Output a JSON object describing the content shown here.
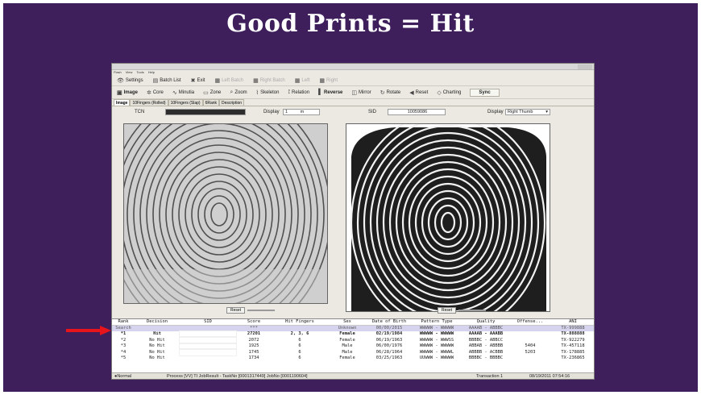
{
  "slide": {
    "title": "Good Prints = Hit"
  },
  "menu": [
    "Flash",
    "View",
    "Tools",
    "Help"
  ],
  "toolbar1": [
    {
      "label": "Settings",
      "icon": "eye-icon",
      "glyph": "👁"
    },
    {
      "label": "Batch List",
      "icon": "list-icon",
      "glyph": "▤"
    },
    {
      "label": "Exit",
      "icon": "exit-icon",
      "glyph": "✖"
    },
    {
      "label": "Left Batch",
      "icon": "grid-icon",
      "glyph": "▦"
    },
    {
      "label": "Right Batch",
      "icon": "grid-icon",
      "glyph": "▦"
    },
    {
      "label": "Left",
      "icon": "grid-icon",
      "glyph": "▦"
    },
    {
      "label": "Right",
      "icon": "grid-icon",
      "glyph": "▦"
    }
  ],
  "toolbar2": [
    {
      "label": "Image",
      "icon": "image-icon",
      "glyph": "▣"
    },
    {
      "label": "Core",
      "icon": "core-icon",
      "glyph": "✲"
    },
    {
      "label": "Minutia",
      "icon": "minutia-icon",
      "glyph": "∿"
    },
    {
      "label": "Zone",
      "icon": "zone-icon",
      "glyph": "▭"
    },
    {
      "label": "Zoom",
      "icon": "zoom-icon",
      "glyph": "⌕"
    },
    {
      "label": "Skeleton",
      "icon": "skeleton-icon",
      "glyph": "⌇"
    },
    {
      "label": "Relation",
      "icon": "relation-icon",
      "glyph": "⟟"
    },
    {
      "label": "Reverse",
      "icon": "reverse-icon",
      "glyph": "▌"
    },
    {
      "label": "Mirror",
      "icon": "mirror-icon",
      "glyph": "◫"
    },
    {
      "label": "Rotate",
      "icon": "rotate-icon",
      "glyph": "↻"
    },
    {
      "label": "Reset",
      "icon": "reset-icon",
      "glyph": "◀"
    },
    {
      "label": "Charting",
      "icon": "charting-icon",
      "glyph": "◇"
    }
  ],
  "sync_label": "Sync",
  "tabs": [
    "Image",
    "10Fingers (Rolled)",
    "10Fingers (Slap)",
    "6Rank",
    "Description"
  ],
  "fields": {
    "tcn_label": "TCN",
    "display_left_label": "Display",
    "display_left_value": "1",
    "display_left_unit": "m",
    "sid_label": "SID",
    "sid_value": "10059086",
    "display_right_label": "Display",
    "display_right_value": "Right Thumb"
  },
  "reset_label": "Reset",
  "table": {
    "headers": [
      "Rank",
      "Decision",
      "SID",
      "Score",
      "Hit Fingers",
      "Sex",
      "Date of Birth",
      "Pattern Type",
      "Quality",
      "Offense...",
      "ANI"
    ],
    "rows": [
      [
        "Search",
        "",
        "",
        "***",
        "",
        "Unknown",
        "00/00/2015",
        "WWWWW - WWWWW",
        "AAAAB - ABBBC",
        "",
        "TX-999888"
      ],
      [
        "*1",
        "Hit",
        "",
        "27201",
        "2, 3, 6",
        "Female",
        "02/19/1984",
        "WWWWW - WWWWW",
        "AAAAB - AAABB",
        "",
        "TX-888888"
      ],
      [
        "*2",
        "No Hit",
        "",
        "2072",
        "6",
        "Female",
        "06/19/1963",
        "WWWWW - WWWSS",
        "BBBBC - ABBCC",
        "",
        "TX-922279"
      ],
      [
        "*3",
        "No Hit",
        "",
        "1925",
        "6",
        "Male",
        "06/00/1976",
        "WWWWW - WWWWW",
        "ABBAB - ABBBB",
        "5404",
        "TX-457118"
      ],
      [
        "*4",
        "No Hit",
        "",
        "1745",
        "6",
        "Male",
        "06/28/1964",
        "WWWWW - WWWWL",
        "ABBBB - ACBBB",
        "5203",
        "TX-178885"
      ],
      [
        "*5",
        "No Hit",
        "",
        "1734",
        "6",
        "Female",
        "03/25/1963",
        "UUWWW - WWWWW",
        "BBBBC - BBBBC",
        "",
        "TX-236865"
      ]
    ]
  },
  "status": {
    "mode": "Normal Mode",
    "process": "Process [VV] TI JobResult - TaskNo [0001317449] JobNo [0001190604]",
    "transaction": "Transaction 1",
    "datetime": "08/19/2011 07:54:16"
  }
}
